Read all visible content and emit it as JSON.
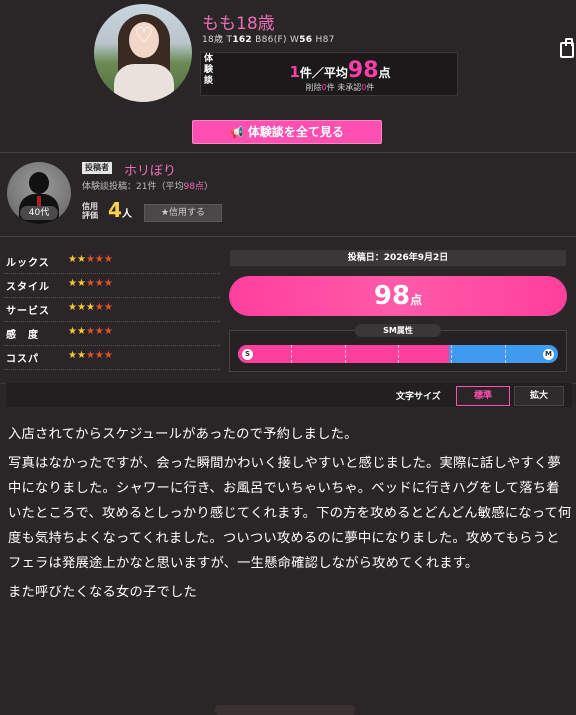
{
  "profile": {
    "name": "もも18歳",
    "stats_prefix": "18歳 T",
    "height": "162",
    "bust_prefix": "B",
    "bust": "86(F)",
    "waist_prefix": "W",
    "waist": "56",
    "hip_prefix": "H",
    "hip": "87"
  },
  "taikendan": {
    "label": "体験談",
    "count": "1",
    "count_unit": "件／平均",
    "average": "98",
    "average_unit": "点",
    "deleted_label": "削除",
    "deleted_count": "0",
    "deleted_unit": "件",
    "unapproved_label": "未承認",
    "unapproved_count": "0",
    "unapproved_unit": "件"
  },
  "view_all_button": "体験談を全て見る",
  "poster": {
    "tag": "投稿者",
    "name": "ホリぼり",
    "posts_label": "体験談投稿：",
    "posts": "21件",
    "avg_open": "（平均",
    "avg": "98点",
    "avg_close": "）",
    "age": "40代",
    "trust_label": "信用評価",
    "trust_value": "4",
    "trust_unit": "人",
    "trust_button": "★信用する"
  },
  "ratings": [
    {
      "label": "ルックス",
      "stars": 2,
      "max": 5
    },
    {
      "label": "スタイル",
      "stars": 2,
      "max": 5
    },
    {
      "label": "サービス",
      "stars": 3,
      "max": 5
    },
    {
      "label": "感　度",
      "stars": 2,
      "max": 5
    },
    {
      "label": "コスパ",
      "stars": 2,
      "max": 5
    }
  ],
  "post_date": "投稿日：2026年9月2日",
  "score": {
    "value": "98",
    "unit": "点"
  },
  "sm": {
    "label": "SM属性",
    "level": 0.66,
    "left": "S",
    "right": "M"
  },
  "font_size": {
    "label": "文字サイズ",
    "normal": "標準",
    "large": "拡大"
  },
  "review_lines": [
    "入店されてからスケジュールがあったので予約しました。",
    "写真はなかったですが、会った瞬間かわいく接しやすいと感じました。実際に話しやすく夢中になりました。シャワーに行き、お風呂でいちゃいちゃ。ベッドに行きハグをして落ち着いたところで、攻めるとしっかり感じてくれます。下の方を攻めるとどんどん敏感になって何度も気持ちよくなってくれました。ついつい攻めるのに夢中になりました。攻めてもらうとフェラは発展途上かなと思いますが、一生懸命確認しながら攻めてくれます。",
    "また呼びたくなる女の子でした"
  ],
  "colors": {
    "accent": "#ff4fb0",
    "name_pink": "#e96fb4",
    "star_on": "#ffc52e",
    "m_blue": "#3e9bf0"
  }
}
